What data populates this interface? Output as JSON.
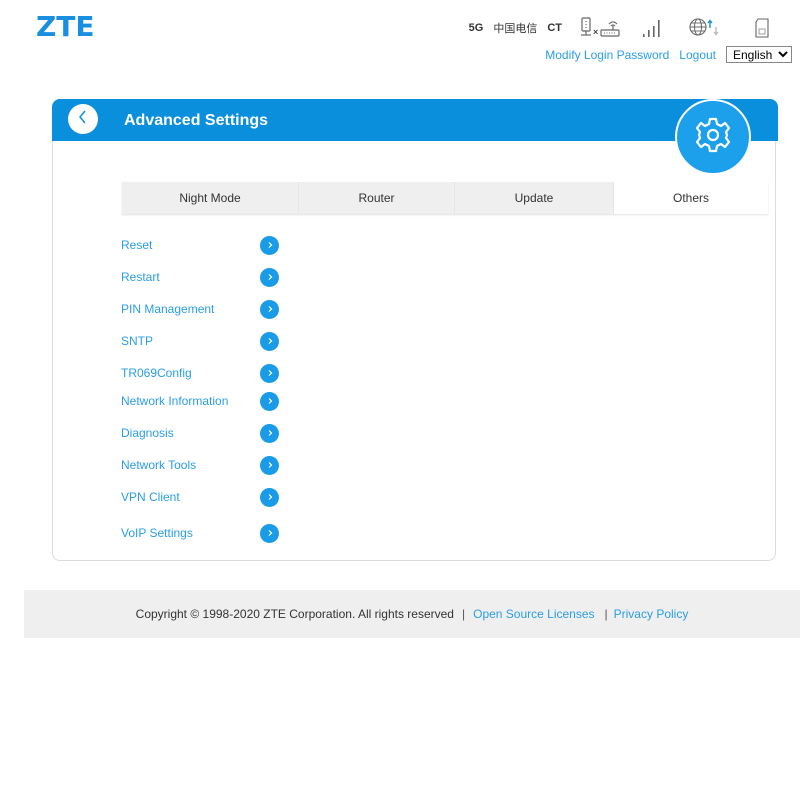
{
  "header": {
    "logo": "ZTE",
    "network_type": "5G",
    "carrier": "中国电信",
    "carrier_short": "CT",
    "status_icons": [
      "router-disconnected-icon",
      "signal-strength-icon",
      "globe-data-transfer-icon",
      "sim-card-icon"
    ],
    "modify_password_label": "Modify Login Password",
    "logout_label": "Logout",
    "language": {
      "selected": "English"
    }
  },
  "card": {
    "title": "Advanced Settings",
    "back_icon": "chevron-left-icon",
    "header_icon": "gear-icon",
    "tabs": [
      {
        "label": "Night Mode",
        "active": false
      },
      {
        "label": "Router",
        "active": false
      },
      {
        "label": "Update",
        "active": false
      },
      {
        "label": "Others",
        "active": true
      }
    ],
    "menu_items": [
      {
        "label": "Reset"
      },
      {
        "label": "Restart"
      },
      {
        "label": "PIN Management"
      },
      {
        "label": "SNTP"
      },
      {
        "label": "TR069Config"
      },
      {
        "label": "Network Information"
      },
      {
        "label": "Diagnosis"
      },
      {
        "label": "Network Tools"
      },
      {
        "label": "VPN Client"
      },
      {
        "label": "VoIP Settings"
      }
    ]
  },
  "footer": {
    "copyright": "Copyright © 1998-2020 ZTE Corporation. All rights reserved",
    "separator": "|",
    "open_source_label": "Open Source Licenses",
    "privacy_label": "Privacy Policy"
  },
  "colors": {
    "brand": "#0a8fdc",
    "link": "#2a9ee6"
  }
}
